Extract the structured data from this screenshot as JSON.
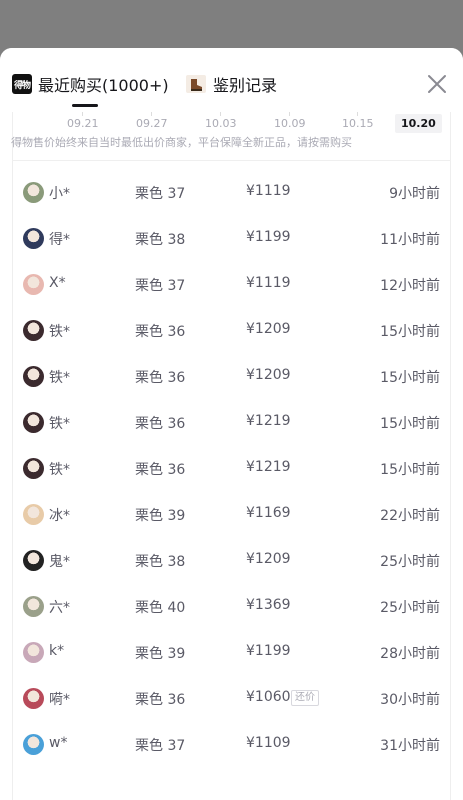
{
  "header": {
    "recent_logo": "得物",
    "recent_tab": "最近购买(1000+)",
    "auth_tab": "鉴别记录"
  },
  "chart": {
    "dates": [
      "09.21",
      "09.27",
      "10.03",
      "10.09",
      "10.15",
      "10.20"
    ],
    "active_date": "10.20"
  },
  "note": "得物售价始终来自当时最低出价商家，平台保障全新正品，请按需购买",
  "rows": [
    {
      "user": "小*",
      "spec": "栗色 37",
      "price": "¥1119",
      "time": "9小时前",
      "avatar_color": "#8a9a7a"
    },
    {
      "user": "得*",
      "spec": "栗色 38",
      "price": "¥1199",
      "time": "11小时前",
      "avatar_color": "#2f3a5c"
    },
    {
      "user": "X*",
      "spec": "栗色 37",
      "price": "¥1119",
      "time": "12小时前",
      "avatar_color": "#e8b8b0"
    },
    {
      "user": "铁*",
      "spec": "栗色 36",
      "price": "¥1209",
      "time": "15小时前",
      "avatar_color": "#3b2a2e"
    },
    {
      "user": "铁*",
      "spec": "栗色 36",
      "price": "¥1209",
      "time": "15小时前",
      "avatar_color": "#3b2a2e"
    },
    {
      "user": "铁*",
      "spec": "栗色 36",
      "price": "¥1219",
      "time": "15小时前",
      "avatar_color": "#3b2a2e"
    },
    {
      "user": "铁*",
      "spec": "栗色 36",
      "price": "¥1219",
      "time": "15小时前",
      "avatar_color": "#3b2a2e"
    },
    {
      "user": "冰*",
      "spec": "栗色 39",
      "price": "¥1169",
      "time": "22小时前",
      "avatar_color": "#e8cba8"
    },
    {
      "user": "鬼*",
      "spec": "栗色 38",
      "price": "¥1209",
      "time": "25小时前",
      "avatar_color": "#222222"
    },
    {
      "user": "六*",
      "spec": "栗色 40",
      "price": "¥1369",
      "time": "25小时前",
      "avatar_color": "#9aa08a"
    },
    {
      "user": "k*",
      "spec": "栗色 39",
      "price": "¥1199",
      "time": "28小时前",
      "avatar_color": "#c8a8b8"
    },
    {
      "user": "嗬*",
      "spec": "栗色 36",
      "price": "¥1060",
      "time": "30小时前",
      "avatar_color": "#b84a5a",
      "badge": "还价"
    },
    {
      "user": "w*",
      "spec": "栗色 37",
      "price": "¥1109",
      "time": "31小时前",
      "avatar_color": "#4aa0d8"
    }
  ]
}
